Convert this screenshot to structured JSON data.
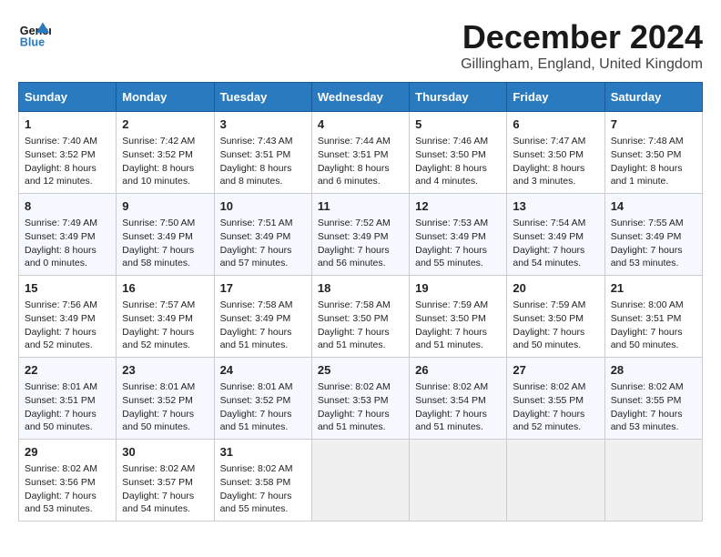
{
  "header": {
    "logo_line1": "General",
    "logo_line2": "Blue",
    "title": "December 2024",
    "subtitle": "Gillingham, England, United Kingdom"
  },
  "calendar": {
    "headers": [
      "Sunday",
      "Monday",
      "Tuesday",
      "Wednesday",
      "Thursday",
      "Friday",
      "Saturday"
    ],
    "weeks": [
      [
        {
          "day": "1",
          "info": "Sunrise: 7:40 AM\nSunset: 3:52 PM\nDaylight: 8 hours\nand 12 minutes."
        },
        {
          "day": "2",
          "info": "Sunrise: 7:42 AM\nSunset: 3:52 PM\nDaylight: 8 hours\nand 10 minutes."
        },
        {
          "day": "3",
          "info": "Sunrise: 7:43 AM\nSunset: 3:51 PM\nDaylight: 8 hours\nand 8 minutes."
        },
        {
          "day": "4",
          "info": "Sunrise: 7:44 AM\nSunset: 3:51 PM\nDaylight: 8 hours\nand 6 minutes."
        },
        {
          "day": "5",
          "info": "Sunrise: 7:46 AM\nSunset: 3:50 PM\nDaylight: 8 hours\nand 4 minutes."
        },
        {
          "day": "6",
          "info": "Sunrise: 7:47 AM\nSunset: 3:50 PM\nDaylight: 8 hours\nand 3 minutes."
        },
        {
          "day": "7",
          "info": "Sunrise: 7:48 AM\nSunset: 3:50 PM\nDaylight: 8 hours\nand 1 minute."
        }
      ],
      [
        {
          "day": "8",
          "info": "Sunrise: 7:49 AM\nSunset: 3:49 PM\nDaylight: 8 hours\nand 0 minutes."
        },
        {
          "day": "9",
          "info": "Sunrise: 7:50 AM\nSunset: 3:49 PM\nDaylight: 7 hours\nand 58 minutes."
        },
        {
          "day": "10",
          "info": "Sunrise: 7:51 AM\nSunset: 3:49 PM\nDaylight: 7 hours\nand 57 minutes."
        },
        {
          "day": "11",
          "info": "Sunrise: 7:52 AM\nSunset: 3:49 PM\nDaylight: 7 hours\nand 56 minutes."
        },
        {
          "day": "12",
          "info": "Sunrise: 7:53 AM\nSunset: 3:49 PM\nDaylight: 7 hours\nand 55 minutes."
        },
        {
          "day": "13",
          "info": "Sunrise: 7:54 AM\nSunset: 3:49 PM\nDaylight: 7 hours\nand 54 minutes."
        },
        {
          "day": "14",
          "info": "Sunrise: 7:55 AM\nSunset: 3:49 PM\nDaylight: 7 hours\nand 53 minutes."
        }
      ],
      [
        {
          "day": "15",
          "info": "Sunrise: 7:56 AM\nSunset: 3:49 PM\nDaylight: 7 hours\nand 52 minutes."
        },
        {
          "day": "16",
          "info": "Sunrise: 7:57 AM\nSunset: 3:49 PM\nDaylight: 7 hours\nand 52 minutes."
        },
        {
          "day": "17",
          "info": "Sunrise: 7:58 AM\nSunset: 3:49 PM\nDaylight: 7 hours\nand 51 minutes."
        },
        {
          "day": "18",
          "info": "Sunrise: 7:58 AM\nSunset: 3:50 PM\nDaylight: 7 hours\nand 51 minutes."
        },
        {
          "day": "19",
          "info": "Sunrise: 7:59 AM\nSunset: 3:50 PM\nDaylight: 7 hours\nand 51 minutes."
        },
        {
          "day": "20",
          "info": "Sunrise: 7:59 AM\nSunset: 3:50 PM\nDaylight: 7 hours\nand 50 minutes."
        },
        {
          "day": "21",
          "info": "Sunrise: 8:00 AM\nSunset: 3:51 PM\nDaylight: 7 hours\nand 50 minutes."
        }
      ],
      [
        {
          "day": "22",
          "info": "Sunrise: 8:01 AM\nSunset: 3:51 PM\nDaylight: 7 hours\nand 50 minutes."
        },
        {
          "day": "23",
          "info": "Sunrise: 8:01 AM\nSunset: 3:52 PM\nDaylight: 7 hours\nand 50 minutes."
        },
        {
          "day": "24",
          "info": "Sunrise: 8:01 AM\nSunset: 3:52 PM\nDaylight: 7 hours\nand 51 minutes."
        },
        {
          "day": "25",
          "info": "Sunrise: 8:02 AM\nSunset: 3:53 PM\nDaylight: 7 hours\nand 51 minutes."
        },
        {
          "day": "26",
          "info": "Sunrise: 8:02 AM\nSunset: 3:54 PM\nDaylight: 7 hours\nand 51 minutes."
        },
        {
          "day": "27",
          "info": "Sunrise: 8:02 AM\nSunset: 3:55 PM\nDaylight: 7 hours\nand 52 minutes."
        },
        {
          "day": "28",
          "info": "Sunrise: 8:02 AM\nSunset: 3:55 PM\nDaylight: 7 hours\nand 53 minutes."
        }
      ],
      [
        {
          "day": "29",
          "info": "Sunrise: 8:02 AM\nSunset: 3:56 PM\nDaylight: 7 hours\nand 53 minutes."
        },
        {
          "day": "30",
          "info": "Sunrise: 8:02 AM\nSunset: 3:57 PM\nDaylight: 7 hours\nand 54 minutes."
        },
        {
          "day": "31",
          "info": "Sunrise: 8:02 AM\nSunset: 3:58 PM\nDaylight: 7 hours\nand 55 minutes."
        },
        {
          "day": "",
          "info": ""
        },
        {
          "day": "",
          "info": ""
        },
        {
          "day": "",
          "info": ""
        },
        {
          "day": "",
          "info": ""
        }
      ]
    ]
  }
}
